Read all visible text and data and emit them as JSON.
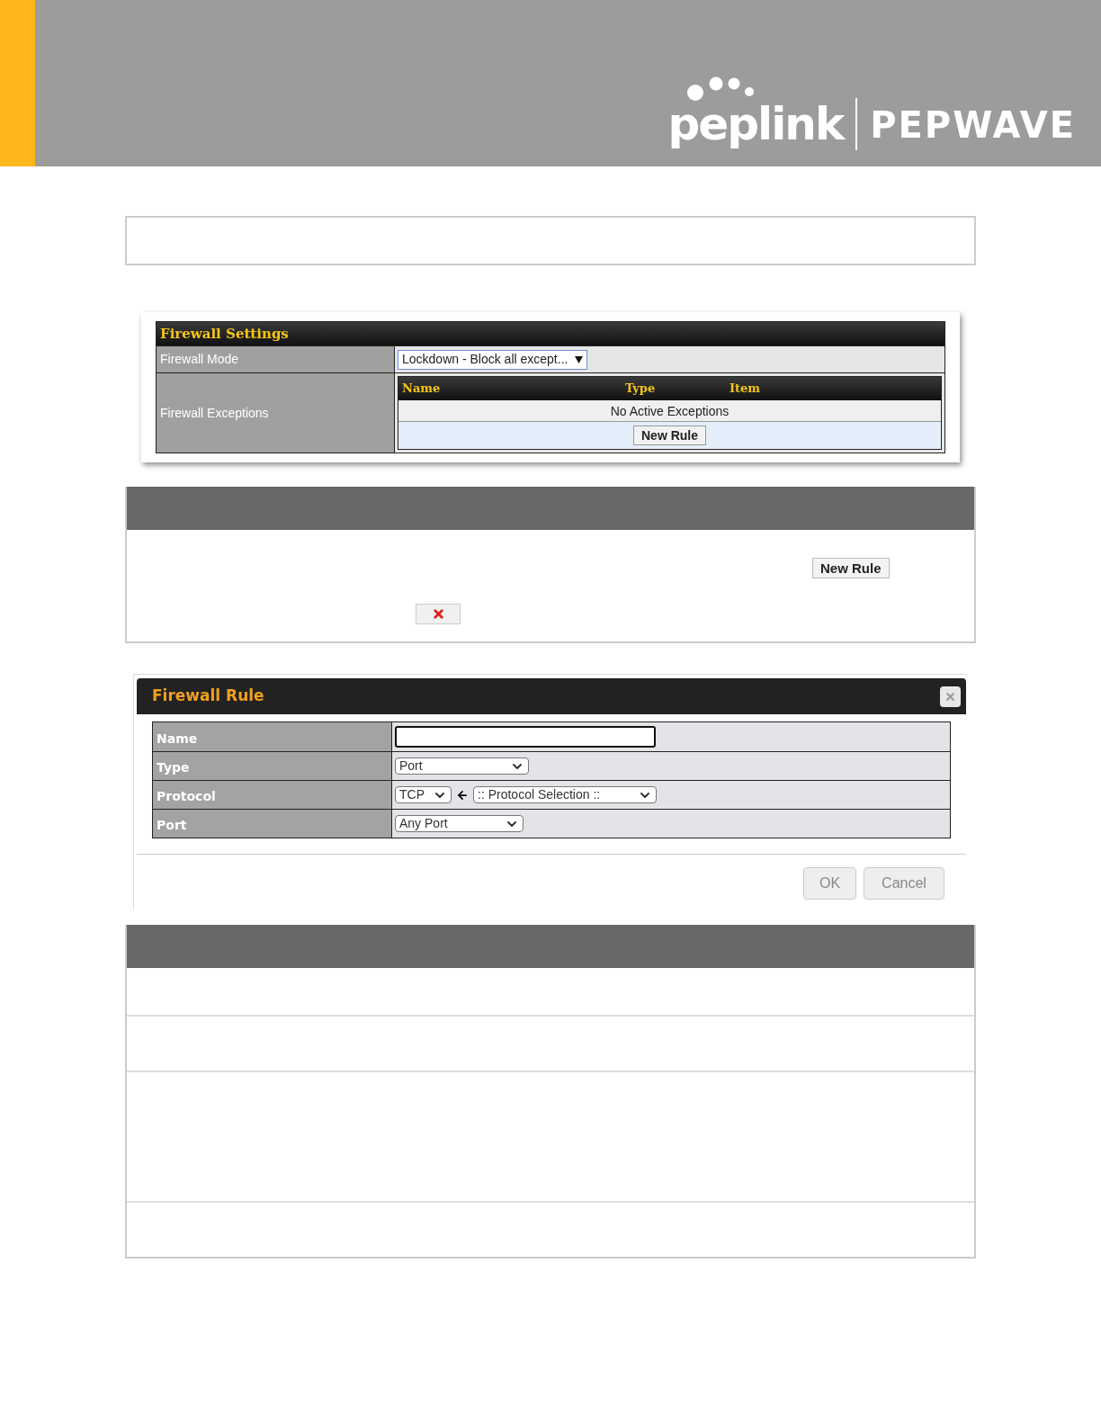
{
  "header": {
    "logo_left": "peplink",
    "logo_right": "PEPWAVE"
  },
  "firewall_settings": {
    "title": "Firewall Settings",
    "rows": [
      {
        "label": "Firewall Mode",
        "kind": "select",
        "value": "Lockdown - Block all except..."
      },
      {
        "label": "Firewall Exceptions",
        "kind": "table",
        "columns": [
          "Name",
          "Type",
          "Item"
        ],
        "empty_text": "No Active Exceptions",
        "button": "New Rule"
      }
    ]
  },
  "rules_table": {
    "button": "New Rule"
  },
  "dialog": {
    "title": "Firewall Rule",
    "fields": [
      {
        "label": "Name",
        "kind": "text"
      },
      {
        "label": "Type",
        "kind": "select",
        "value": "Port"
      },
      {
        "label": "Protocol",
        "kind": "protocol",
        "value": "TCP",
        "selection": ":: Protocol Selection ::"
      },
      {
        "label": "Port",
        "kind": "select",
        "value": "Any Port"
      }
    ],
    "buttons": [
      "OK",
      "Cancel"
    ]
  }
}
